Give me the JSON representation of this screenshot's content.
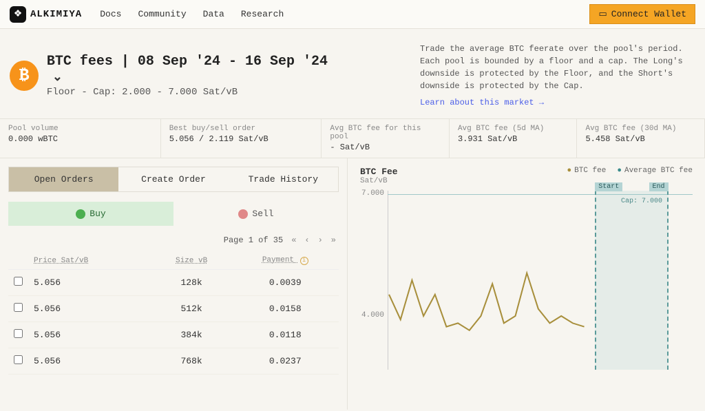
{
  "brand": {
    "name": "ALKIMIYA"
  },
  "nav": {
    "docs": "Docs",
    "community": "Community",
    "data": "Data",
    "research": "Research"
  },
  "wallet": {
    "connect": "Connect Wallet"
  },
  "hero": {
    "title": "BTC fees | 08 Sep '24 - 16 Sep '24",
    "subtitle": "Floor - Cap: 2.000 - 7.000 Sat/vB",
    "description": "Trade the average BTC feerate over the pool's period. Each pool is bounded by a floor and a cap. The Long's downside is protected by the Floor, and the Short's downside is protected by the Cap.",
    "learn": "Learn about this market →"
  },
  "stats": [
    {
      "label": "Pool volume",
      "value": "0.000 wBTC"
    },
    {
      "label": "Best buy/sell order",
      "value": "5.056 / 2.119 Sat/vB"
    },
    {
      "label": "Avg BTC fee for this pool",
      "value": "- Sat/vB"
    },
    {
      "label": "Avg BTC fee (5d MA)",
      "value": "3.931 Sat/vB"
    },
    {
      "label": "Avg BTC fee (30d MA)",
      "value": "5.458 Sat/vB"
    }
  ],
  "tabs": {
    "open_orders": "Open Orders",
    "create_order": "Create Order",
    "trade_history": "Trade History"
  },
  "sides": {
    "buy": "Buy",
    "sell": "Sell"
  },
  "pager": {
    "text": "Page 1 of 35"
  },
  "table": {
    "headers": {
      "price": "Price Sat/vB",
      "size": "Size vB",
      "payment": "Payment"
    },
    "rows": [
      {
        "price": "5.056",
        "size": "128k",
        "payment": "0.0039"
      },
      {
        "price": "5.056",
        "size": "512k",
        "payment": "0.0158"
      },
      {
        "price": "5.056",
        "size": "384k",
        "payment": "0.0118"
      },
      {
        "price": "5.056",
        "size": "768k",
        "payment": "0.0237"
      }
    ]
  },
  "chart": {
    "title": "BTC Fee",
    "ylabel_unit": "Sat/vB",
    "legend": {
      "btcfee": "BTC fee",
      "avgfee": "Average BTC fee"
    },
    "cap_label": "Cap: 7.000",
    "start_label": "Start",
    "end_label": "End",
    "y_ticks": {
      "top": "7.000",
      "mid": "4.000"
    }
  },
  "chart_data": {
    "type": "line",
    "ylabel": "Sat/vB",
    "ylim": [
      2.0,
      7.0
    ],
    "cap": 7.0,
    "series": [
      {
        "name": "BTC fee",
        "color": "#a88f3c",
        "values": [
          4.1,
          3.4,
          4.5,
          3.5,
          4.1,
          3.2,
          3.3,
          3.1,
          3.5,
          4.4,
          3.3,
          3.5,
          4.7,
          3.7,
          3.3,
          3.5,
          3.3,
          3.2
        ]
      }
    ],
    "period_band": {
      "start_frac": 0.68,
      "end_frac": 0.92
    }
  }
}
